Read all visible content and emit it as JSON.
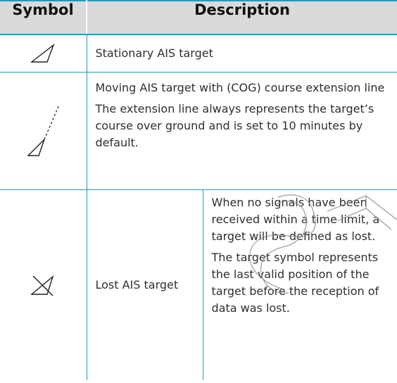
{
  "table": {
    "headers": {
      "symbol": "Symbol",
      "description": "Description"
    },
    "rows": [
      {
        "icon": "stationary-ais-target-icon",
        "paragraphs": [
          "Stationary AIS target"
        ]
      },
      {
        "icon": "moving-ais-target-icon",
        "paragraphs": [
          "Moving AIS target with (COG) course extension line",
          "The extension line always represents the target’s course over ground and is set to 10 minutes by default."
        ]
      },
      {
        "icon": "lost-ais-target-icon",
        "label": "Lost AIS target",
        "paragraphs": [
          "When no signals have been received within a time limit, a target will be defined as lost.",
          "The target symbol represents the last valid position of the target before the reception of data was lost."
        ]
      }
    ]
  },
  "colors": {
    "accent_line": "#1f9cbd",
    "header_bg": "#d9dadb",
    "text": "#2f2f2f"
  }
}
